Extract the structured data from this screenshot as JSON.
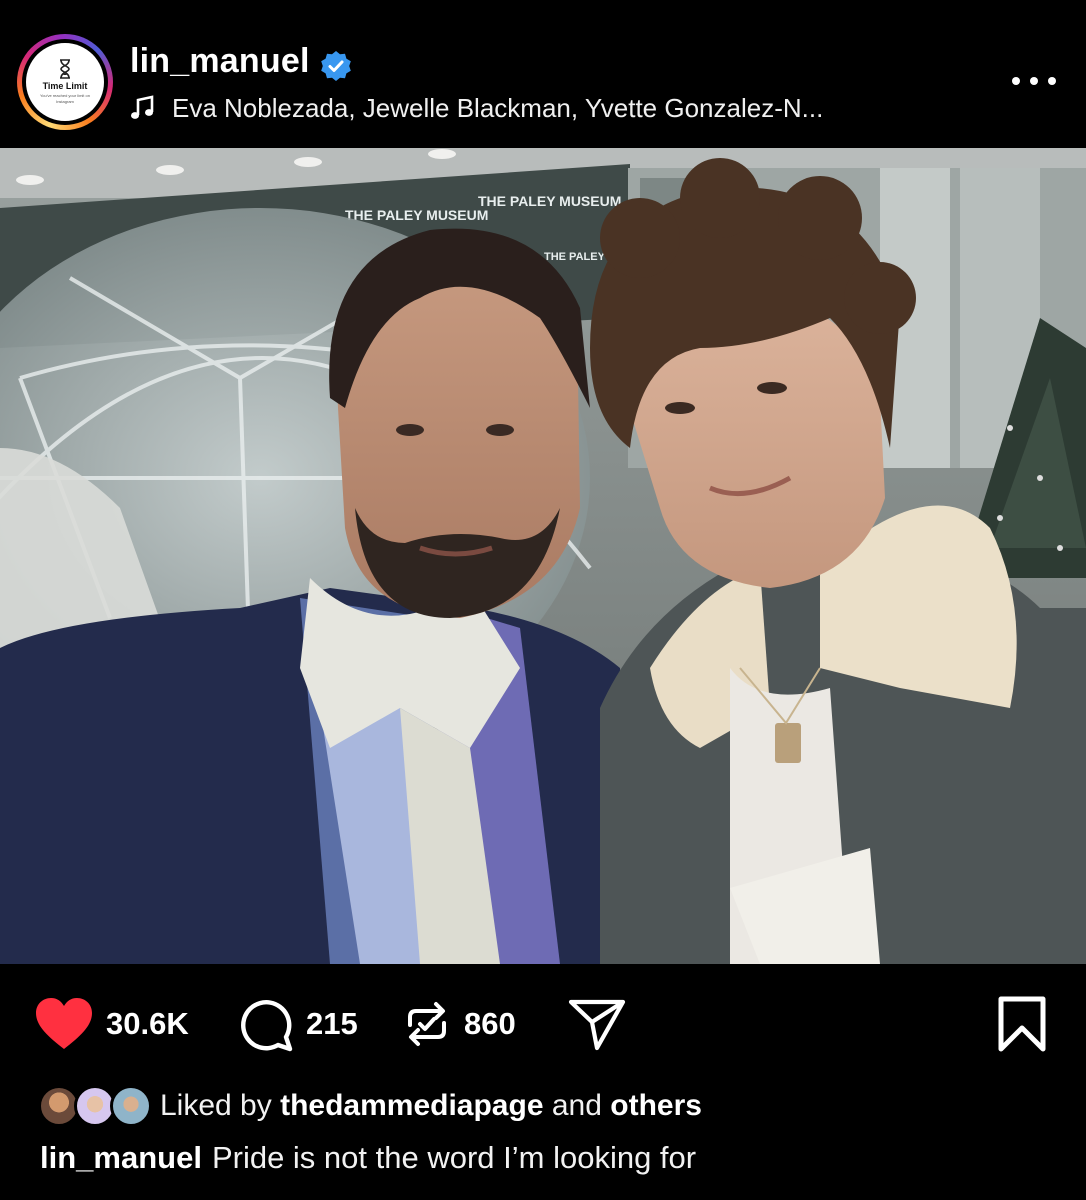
{
  "post": {
    "username": "lin_manuel",
    "verified": true,
    "avatar": {
      "title": "Time Limit",
      "subtitle": "You've reached your limit on Instagram",
      "icon": "hourglass-icon"
    },
    "audio": "Eva Noblezada, Jewelle Blackman, Yvette Gonzalez-N...",
    "photo_signage": [
      "THE PALEY MUSEUM",
      "THE PALEY MUSEUM",
      "THE PALEY MUSEUM",
      "THE PALEY MUSEUM"
    ],
    "actions": {
      "likes": "30.6K",
      "comments": "215",
      "reposts": "860"
    },
    "liked_by": {
      "prefix": "Liked by",
      "user": "thedammediapage",
      "middle": "and",
      "suffix": "others"
    },
    "caption": {
      "user": "lin_manuel",
      "text": "Pride is not the word I’m looking for"
    }
  },
  "colors": {
    "background": "#000000",
    "like_red": "#ff3040",
    "verified_blue": "#3897f0",
    "text": "#ffffff"
  }
}
